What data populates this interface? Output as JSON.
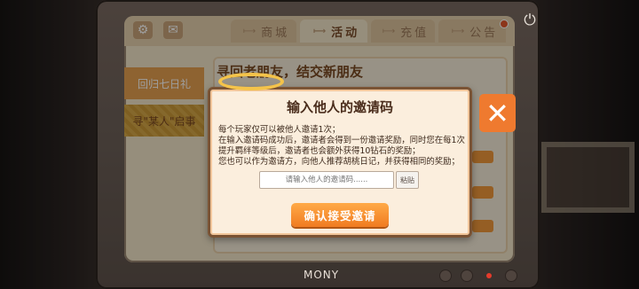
{
  "screen": {
    "tabs": [
      {
        "label": "商城",
        "deco": "⟼⦁⟻"
      },
      {
        "label": "活动",
        "deco": "⟼⦁⟻"
      },
      {
        "label": "充值",
        "deco": "⟼⦁⟻"
      },
      {
        "label": "公告",
        "deco": "⟼⦁⟻"
      }
    ],
    "active_tab": "活动",
    "sidebar": [
      {
        "label": "回归七日礼"
      },
      {
        "label": "寻\"某人\"启事"
      }
    ],
    "content_title": "寻回老朋友，结交新朋友",
    "icons": {
      "settings": "gear-icon",
      "mail": "mail-icon",
      "power": "power-icon"
    }
  },
  "monitor": {
    "brand": "MONY"
  },
  "dialog": {
    "title": "输入他人的邀请码",
    "rules": [
      "每个玩家仅可以被他人邀请1次；",
      "在输入邀请码成功后，邀请者会得到一份邀请奖励，同时您在每1次",
      "提升羁绊等级后，邀请者也会额外获得10钻石的奖励；",
      "您也可以作为邀请方，向他人推荐胡桃日记，并获得相同的奖励；"
    ],
    "input_placeholder": "请输入他人的邀请码......",
    "paste_label": "粘贴",
    "confirm_label": "确认接受邀请",
    "close_icon": "close-icon"
  },
  "colors": {
    "accent": "#f07b21",
    "title_brown": "#4a2d1c",
    "close_bg": "#ef7a2f"
  }
}
